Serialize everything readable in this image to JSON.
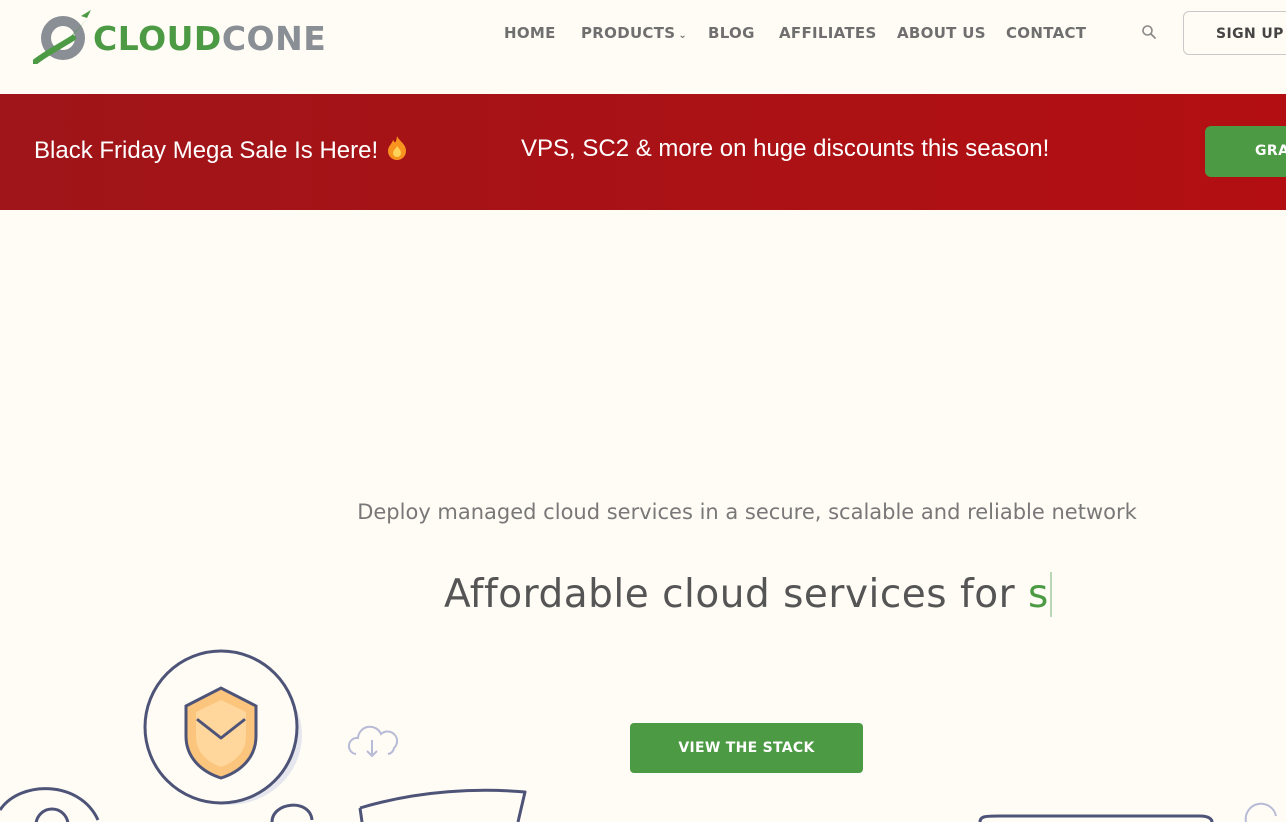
{
  "header": {
    "logo_text_green": "CLOUD",
    "logo_text_gray": "CONE",
    "nav": [
      {
        "label": "HOME"
      },
      {
        "label": "PRODUCTS",
        "has_dropdown": true
      },
      {
        "label": "BLOG"
      },
      {
        "label": "AFFILIATES"
      },
      {
        "label": "ABOUT US"
      },
      {
        "label": "CONTACT"
      }
    ],
    "search_icon": "search-icon",
    "signup_label": "SIGN UP"
  },
  "banner": {
    "title": "Black Friday Mega Sale Is Here!",
    "title_icon": "fire-icon",
    "subtitle": "VPS, SC2 & more on huge discounts this season!",
    "button_label": "GRA",
    "background": "#a8121a",
    "button_color": "#4c9a44"
  },
  "hero": {
    "tagline": "Deploy managed cloud services in a secure, scalable and reliable network",
    "headline_static": "Affordable cloud services for ",
    "headline_typed": "s",
    "cta_label": "VIEW THE STACK",
    "accent_color": "#4c9a44",
    "illustration_icons": [
      "shield-icon",
      "cloud-download-icon"
    ]
  }
}
